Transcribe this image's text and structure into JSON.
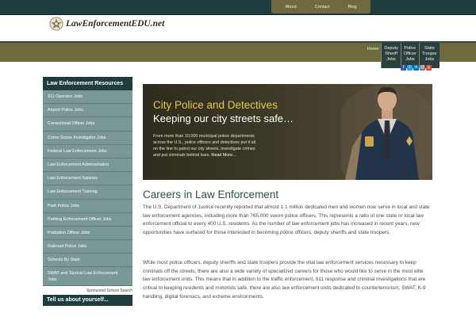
{
  "topnav": {
    "items": [
      "About",
      "Contact",
      "Blog"
    ]
  },
  "logo": {
    "text": "LawEnforcementEDU.net"
  },
  "nav": {
    "items": [
      "Home",
      "Deputy\nSheriff\nJobs",
      "Police\nOfficer\nJobs",
      "State\nTrooper\nJobs"
    ]
  },
  "social": [
    {
      "icon": "facebook-icon",
      "glyph": "f",
      "color": "#3b5998"
    },
    {
      "icon": "twitter-icon",
      "glyph": "t",
      "color": "#1da1f2"
    },
    {
      "icon": "linkedin-icon",
      "glyph": "in",
      "color": "#0077b5"
    },
    {
      "icon": "email-icon",
      "glyph": "@",
      "color": "#7a7a7a"
    },
    {
      "icon": "googleplus-icon",
      "glyph": "g",
      "color": "#d34836"
    }
  ],
  "sidebar": {
    "title": "Law Enforcement Resources",
    "items": [
      "911 Operator Jobs",
      "Airport Police Jobs",
      "Correctional Officer Jobs",
      "Crime Scene Investigator Jobs",
      "Federal Law Enforcement Jobs",
      "Law Enforcement Administration",
      "Law Enforcement Salaries",
      "Law Enforcement Training",
      "Park Police Jobs",
      "Parking Enforcement Officer Jobs",
      "Probation Officer Jobs",
      "Railroad Police Jobs",
      "Schools By State",
      "SWAT and Tactical Law Enforcement Jobs"
    ],
    "sponsor": "Sponsored School Search",
    "bottom_title": "Tell us about yourself..."
  },
  "hero": {
    "title": "City Police and Detectives",
    "subtitle": "Keeping our city streets safe…",
    "text": "From more than 10,000 municipal police departments across the U.S., police officers and detectives put it all on the line to patrol our city streets, investigate crimes and put criminals behind bars.",
    "read_more": "Read More…"
  },
  "main": {
    "heading": "Careers in Law Enforcement",
    "para1": "The U.S. Department of Justice recently reported that almost 1.1 million dedicated men and women now serve in local and state law enforcement agencies, including more than 765,000 sworn police officers. This represents a ratio of one state or local law enforcement official to every 400 U.S. residents. As the number of law enforcement jobs has increased in recent years, new opportunities have surfaced for those interested in becoming police officers, deputy sheriffs and state troopers.",
    "para2": "While most police officers, deputy sheriffs and state troopers provide the vital law enforcement services necessary to keep criminals off the streets, there are also a wide variety of specialized careers for those who would like to serve in the most elite law enforcement units. This means that in addition to the traffic enforcement, 911 response and criminal investigations that are critical to keeping residents and motorists safe, there are also law enforcement units dedicated to counterterrorism, SWAT, K-9 handling, digital forensics, and extreme environments."
  }
}
